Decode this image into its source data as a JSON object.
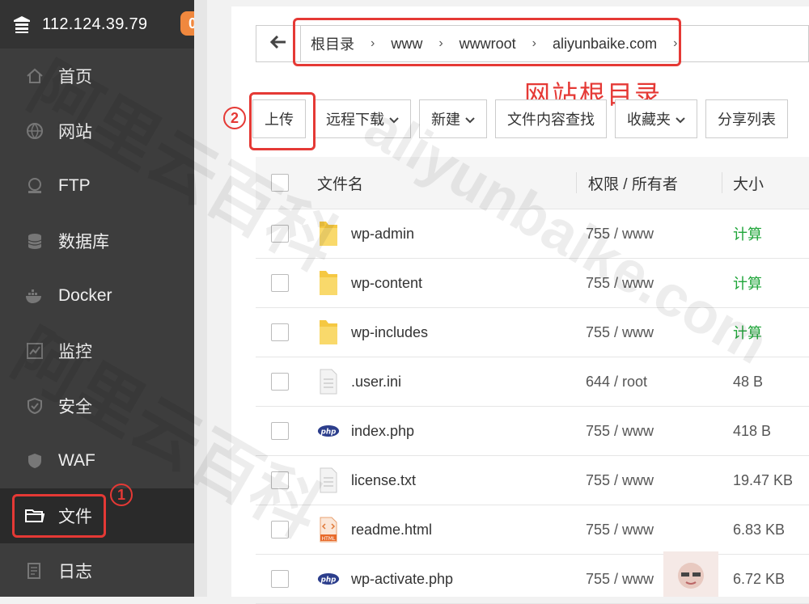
{
  "header": {
    "ip": "112.124.39.79",
    "badge_count": "0"
  },
  "nav": [
    {
      "label": "首页",
      "icon": "home-icon"
    },
    {
      "label": "网站",
      "icon": "globe-icon"
    },
    {
      "label": "FTP",
      "icon": "ftp-icon"
    },
    {
      "label": "数据库",
      "icon": "database-icon"
    },
    {
      "label": "Docker",
      "icon": "docker-icon"
    },
    {
      "label": "监控",
      "icon": "monitor-icon"
    },
    {
      "label": "安全",
      "icon": "shield-icon"
    },
    {
      "label": "WAF",
      "icon": "waf-icon"
    },
    {
      "label": "文件",
      "icon": "folder-icon"
    },
    {
      "label": "日志",
      "icon": "log-icon"
    }
  ],
  "annotations": {
    "step1": "1",
    "step2": "2",
    "root_label": "网站根目录"
  },
  "path": [
    "根目录",
    "www",
    "wwwroot",
    "aliyunbaike.com"
  ],
  "toolbar": {
    "upload": "上传",
    "remote_download": "远程下载",
    "new": "新建",
    "search_content": "文件内容查找",
    "favorites": "收藏夹",
    "share_list": "分享列表"
  },
  "table": {
    "headers": {
      "name": "文件名",
      "perm": "权限 / 所有者",
      "size": "大小"
    },
    "rows": [
      {
        "type": "folder",
        "name": "wp-admin",
        "perm": "755 / www",
        "size": "计算"
      },
      {
        "type": "folder",
        "name": "wp-content",
        "perm": "755 / www",
        "size": "计算"
      },
      {
        "type": "folder",
        "name": "wp-includes",
        "perm": "755 / www",
        "size": "计算"
      },
      {
        "type": "file",
        "name": ".user.ini",
        "perm": "644 / root",
        "size": "48 B"
      },
      {
        "type": "php",
        "name": "index.php",
        "perm": "755 / www",
        "size": "418 B"
      },
      {
        "type": "file",
        "name": "license.txt",
        "perm": "755 / www",
        "size": "19.47 KB"
      },
      {
        "type": "html",
        "name": "readme.html",
        "perm": "755 / www",
        "size": "6.83 KB"
      },
      {
        "type": "php",
        "name": "wp-activate.php",
        "perm": "755 / www",
        "size": "6.72 KB"
      }
    ]
  },
  "watermark": {
    "cn": "阿里云百科",
    "en": "aliyunbaike.com"
  },
  "colors": {
    "accent_red": "#e53935",
    "calc_green": "#20a53a",
    "badge_orange": "#f0883e",
    "sidebar": "#3d3d3d"
  }
}
